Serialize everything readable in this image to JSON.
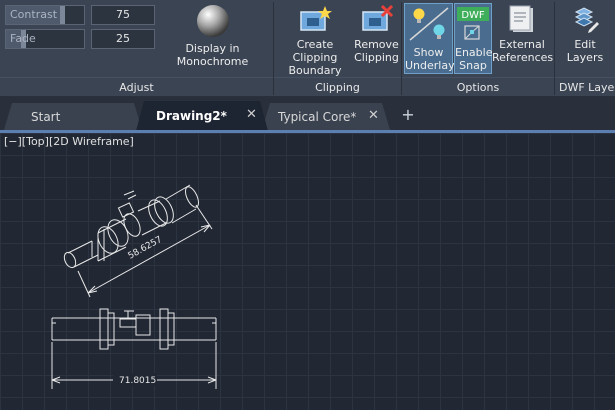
{
  "adjust": {
    "title": "Adjust",
    "contrast": {
      "label": "Contrast",
      "value": "75",
      "level": 0.75
    },
    "fade": {
      "label": "Fade",
      "value": "25",
      "level": 0.25
    },
    "monochrome_label": "Display in Monochrome"
  },
  "clipping": {
    "title": "Clipping",
    "create_label_1": "Create Clipping",
    "create_label_2": "Boundary",
    "remove_label_1": "Remove",
    "remove_label_2": "Clipping"
  },
  "options": {
    "title": "Options",
    "show_label_1": "Show",
    "show_label_2": "Underlay",
    "snap_label_1": "Enable",
    "snap_label_2": "Snap",
    "snap_badge": "DWF",
    "external_label_1": "External",
    "external_label_2": "References"
  },
  "dwf_layers": {
    "title": "DWF Layers",
    "edit_label_1": "Edit",
    "edit_label_2": "Layers"
  },
  "tabs": [
    {
      "label": "Start"
    },
    {
      "label": "Drawing2*",
      "close": "✕"
    },
    {
      "label": "Typical Core*",
      "close": "✕"
    }
  ],
  "tab_add": "+",
  "viewport": {
    "label": "[−][Top][2D Wireframe]",
    "dim_iso": "58.6257",
    "dim_plan": "71.8015"
  },
  "colors": {
    "accent": "#5b7fb0",
    "ribbon_bg": "#3b4453",
    "viewport_bg": "#212833"
  }
}
